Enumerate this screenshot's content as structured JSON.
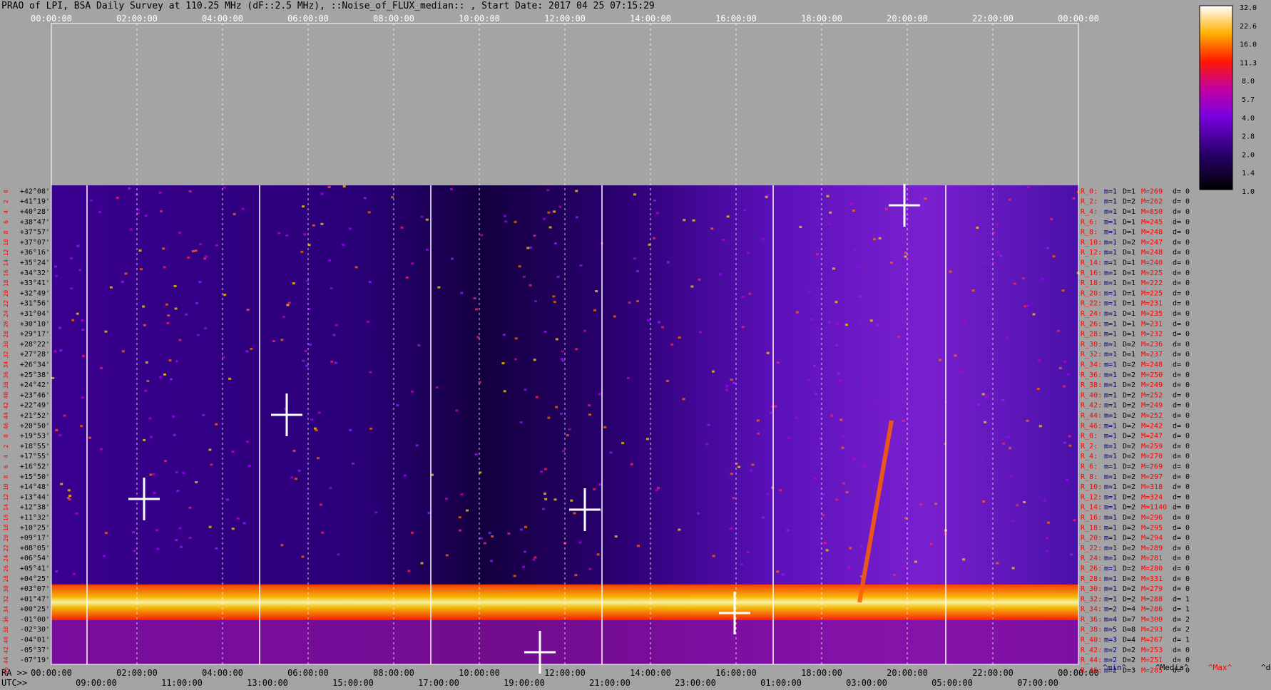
{
  "title": "PRAO of LPI, BSA Daily Survey at 110.25 MHz (dF::2.5 MHz), ::Noise_of_FLUX_median:: , Start Date: 2017 04 25 07:15:29",
  "chart_data": {
    "type": "heatmap",
    "colormap": "gnuplot (black-purple-red-yellow-white)",
    "x_top_ticks": [
      "00:00:00",
      "02:00:00",
      "04:00:00",
      "06:00:00",
      "08:00:00",
      "10:00:00",
      "12:00:00",
      "14:00:00",
      "16:00:00",
      "18:00:00",
      "20:00:00",
      "22:00:00",
      "00:00:00"
    ],
    "ra_prefix": "RA >>",
    "ra_ticks": [
      "00:00:00",
      "02:00:00",
      "04:00:00",
      "06:00:00",
      "08:00:00",
      "10:00:00",
      "12:00:00",
      "14:00:00",
      "16:00:00",
      "18:00:00",
      "20:00:00",
      "22:00:00",
      "00:00:00"
    ],
    "utc_prefix": "UTC>>",
    "utc_ticks": [
      "09:00:00",
      "11:00:00",
      "13:00:00",
      "15:00:00",
      "17:00:00",
      "19:00:00",
      "21:00:00",
      "23:00:00",
      "01:00:00",
      "03:00:00",
      "05:00:00",
      "07:00:00"
    ],
    "colorbar": {
      "ticks": [
        "32.0",
        "22.6",
        "16.0",
        "11.3",
        "8.0",
        "5.7",
        "4.0",
        "2.8",
        "2.0",
        "1.4",
        "1.0"
      ],
      "scale": "log",
      "range": [
        1.0,
        32.0
      ]
    },
    "declinations": [
      "+42°08'",
      "+41°19'",
      "+40°28'",
      "+38°47'",
      "+37°57'",
      "+37°07'",
      "+36°16'",
      "+35°24'",
      "+34°32'",
      "+33°41'",
      "+32°49'",
      "+31°56'",
      "+31°04'",
      "+30°10'",
      "+29°17'",
      "+28°22'",
      "+27°28'",
      "+26°34'",
      "+25°38'",
      "+24°42'",
      "+23°46'",
      "+22°49'",
      "+21°52'",
      "+20°50'",
      "+19°53'",
      "+18°55'",
      "+17°55'",
      "+16°52'",
      "+15°50'",
      "+14°48'",
      "+13°44'",
      "+12°38'",
      "+11°32'",
      "+10°25'",
      "+09°17'",
      "+08°05'",
      "+06°54'",
      "+05°41'",
      "+04°25'",
      "+03°07'",
      "+01°47'",
      "+00°25'",
      "-01°00'",
      "-02°30'",
      "-04°01'",
      "-05°37'",
      "-07°19'"
    ],
    "beam_numbers": [
      "0",
      "2",
      "4",
      "6",
      "8",
      "10",
      "12",
      "14",
      "16",
      "18",
      "20",
      "22",
      "24",
      "26",
      "28",
      "30",
      "32",
      "34",
      "36",
      "38",
      "40",
      "42",
      "44",
      "46",
      "0",
      "2",
      "4",
      "6",
      "8",
      "10",
      "12",
      "14",
      "16",
      "18",
      "20",
      "22",
      "24",
      "26",
      "28",
      "30",
      "32",
      "34",
      "36",
      "38",
      "40",
      "42",
      "44",
      "46"
    ],
    "stats": [
      {
        "r": "R_0:",
        "m": "m=1",
        "d": "D=1",
        "M": "M=269",
        "dv": "d= 0"
      },
      {
        "r": "R_2:",
        "m": "m=1",
        "d": "D=2",
        "M": "M=262",
        "dv": "d= 0"
      },
      {
        "r": "R_4:",
        "m": "m=1",
        "d": "D=1",
        "M": "M=850",
        "dv": "d= 0"
      },
      {
        "r": "R_6:",
        "m": "m=1",
        "d": "D=1",
        "M": "M=245",
        "dv": "d= 0"
      },
      {
        "r": "R_8:",
        "m": "m=1",
        "d": "D=1",
        "M": "M=248",
        "dv": "d= 0"
      },
      {
        "r": "R_10:",
        "m": "m=1",
        "d": "D=2",
        "M": "M=247",
        "dv": "d= 0"
      },
      {
        "r": "R_12:",
        "m": "m=1",
        "d": "D=1",
        "M": "M=248",
        "dv": "d= 0"
      },
      {
        "r": "R_14:",
        "m": "m=1",
        "d": "D=1",
        "M": "M=240",
        "dv": "d= 0"
      },
      {
        "r": "R_16:",
        "m": "m=1",
        "d": "D=1",
        "M": "M=225",
        "dv": "d= 0"
      },
      {
        "r": "R_18:",
        "m": "m=1",
        "d": "D=1",
        "M": "M=222",
        "dv": "d= 0"
      },
      {
        "r": "R_20:",
        "m": "m=1",
        "d": "D=1",
        "M": "M=225",
        "dv": "d= 0"
      },
      {
        "r": "R_22:",
        "m": "m=1",
        "d": "D=1",
        "M": "M=231",
        "dv": "d= 0"
      },
      {
        "r": "R_24:",
        "m": "m=1",
        "d": "D=1",
        "M": "M=235",
        "dv": "d= 0"
      },
      {
        "r": "R_26:",
        "m": "m=1",
        "d": "D=1",
        "M": "M=231",
        "dv": "d= 0"
      },
      {
        "r": "R_28:",
        "m": "m=1",
        "d": "D=1",
        "M": "M=232",
        "dv": "d= 0"
      },
      {
        "r": "R_30:",
        "m": "m=1",
        "d": "D=2",
        "M": "M=236",
        "dv": "d= 0"
      },
      {
        "r": "R_32:",
        "m": "m=1",
        "d": "D=1",
        "M": "M=237",
        "dv": "d= 0"
      },
      {
        "r": "R_34:",
        "m": "m=1",
        "d": "D=2",
        "M": "M=248",
        "dv": "d= 0"
      },
      {
        "r": "R_36:",
        "m": "m=1",
        "d": "D=2",
        "M": "M=250",
        "dv": "d= 0"
      },
      {
        "r": "R_38:",
        "m": "m=1",
        "d": "D=2",
        "M": "M=249",
        "dv": "d= 0"
      },
      {
        "r": "R_40:",
        "m": "m=1",
        "d": "D=2",
        "M": "M=252",
        "dv": "d= 0"
      },
      {
        "r": "R_42:",
        "m": "m=1",
        "d": "D=2",
        "M": "M=249",
        "dv": "d= 0"
      },
      {
        "r": "R_44:",
        "m": "m=1",
        "d": "D=2",
        "M": "M=252",
        "dv": "d= 0"
      },
      {
        "r": "R_46:",
        "m": "m=1",
        "d": "D=2",
        "M": "M=242",
        "dv": "d= 0"
      },
      {
        "r": "R_0:",
        "m": "m=1",
        "d": "D=2",
        "M": "M=247",
        "dv": "d= 0"
      },
      {
        "r": "R_2:",
        "m": "m=1",
        "d": "D=2",
        "M": "M=259",
        "dv": "d= 0"
      },
      {
        "r": "R_4:",
        "m": "m=1",
        "d": "D=2",
        "M": "M=270",
        "dv": "d= 0"
      },
      {
        "r": "R_6:",
        "m": "m=1",
        "d": "D=2",
        "M": "M=269",
        "dv": "d= 0"
      },
      {
        "r": "R_8:",
        "m": "m=1",
        "d": "D=2",
        "M": "M=297",
        "dv": "d= 0"
      },
      {
        "r": "R_10:",
        "m": "m=1",
        "d": "D=2",
        "M": "M=318",
        "dv": "d= 0"
      },
      {
        "r": "R_12:",
        "m": "m=1",
        "d": "D=2",
        "M": "M=324",
        "dv": "d= 0"
      },
      {
        "r": "R_14:",
        "m": "m=1",
        "d": "D=2",
        "M": "M=1140",
        "dv": "d= 0"
      },
      {
        "r": "R_16:",
        "m": "m=1",
        "d": "D=2",
        "M": "M=296",
        "dv": "d= 0"
      },
      {
        "r": "R_18:",
        "m": "m=1",
        "d": "D=2",
        "M": "M=295",
        "dv": "d= 0"
      },
      {
        "r": "R_20:",
        "m": "m=1",
        "d": "D=2",
        "M": "M=294",
        "dv": "d= 0"
      },
      {
        "r": "R_22:",
        "m": "m=1",
        "d": "D=2",
        "M": "M=289",
        "dv": "d= 0"
      },
      {
        "r": "R_24:",
        "m": "m=1",
        "d": "D=2",
        "M": "M=281",
        "dv": "d= 0"
      },
      {
        "r": "R_26:",
        "m": "m=1",
        "d": "D=2",
        "M": "M=280",
        "dv": "d= 0"
      },
      {
        "r": "R_28:",
        "m": "m=1",
        "d": "D=2",
        "M": "M=331",
        "dv": "d= 0"
      },
      {
        "r": "R_30:",
        "m": "m=1",
        "d": "D=2",
        "M": "M=279",
        "dv": "d= 0"
      },
      {
        "r": "R_32:",
        "m": "m=1",
        "d": "D=2",
        "M": "M=288",
        "dv": "d= 1"
      },
      {
        "r": "R_34:",
        "m": "m=2",
        "d": "D=4",
        "M": "M=286",
        "dv": "d= 1"
      },
      {
        "r": "R_36:",
        "m": "m=4",
        "d": "D=7",
        "M": "M=300",
        "dv": "d= 2"
      },
      {
        "r": "R_38:",
        "m": "m=5",
        "d": "D=8",
        "M": "M=293",
        "dv": "d= 2"
      },
      {
        "r": "R_40:",
        "m": "m=3",
        "d": "D=4",
        "M": "M=267",
        "dv": "d= 1"
      },
      {
        "r": "R_42:",
        "m": "m=2",
        "d": "D=2",
        "M": "M=253",
        "dv": "d= 0"
      },
      {
        "r": "R_44:",
        "m": "m=2",
        "d": "D=2",
        "M": "M=251",
        "dv": "d= 0"
      },
      {
        "r": "R_46:",
        "m": "m=2",
        "d": "D=3",
        "M": "M=285",
        "dv": "d= 0"
      }
    ],
    "stats_legend": [
      "^min^",
      "^Media^",
      "^Max^",
      "^devia^"
    ],
    "colors": {
      "background": "#a4a4a4",
      "min": "#00007a",
      "max": "#ff0000",
      "text": "#000000"
    }
  }
}
